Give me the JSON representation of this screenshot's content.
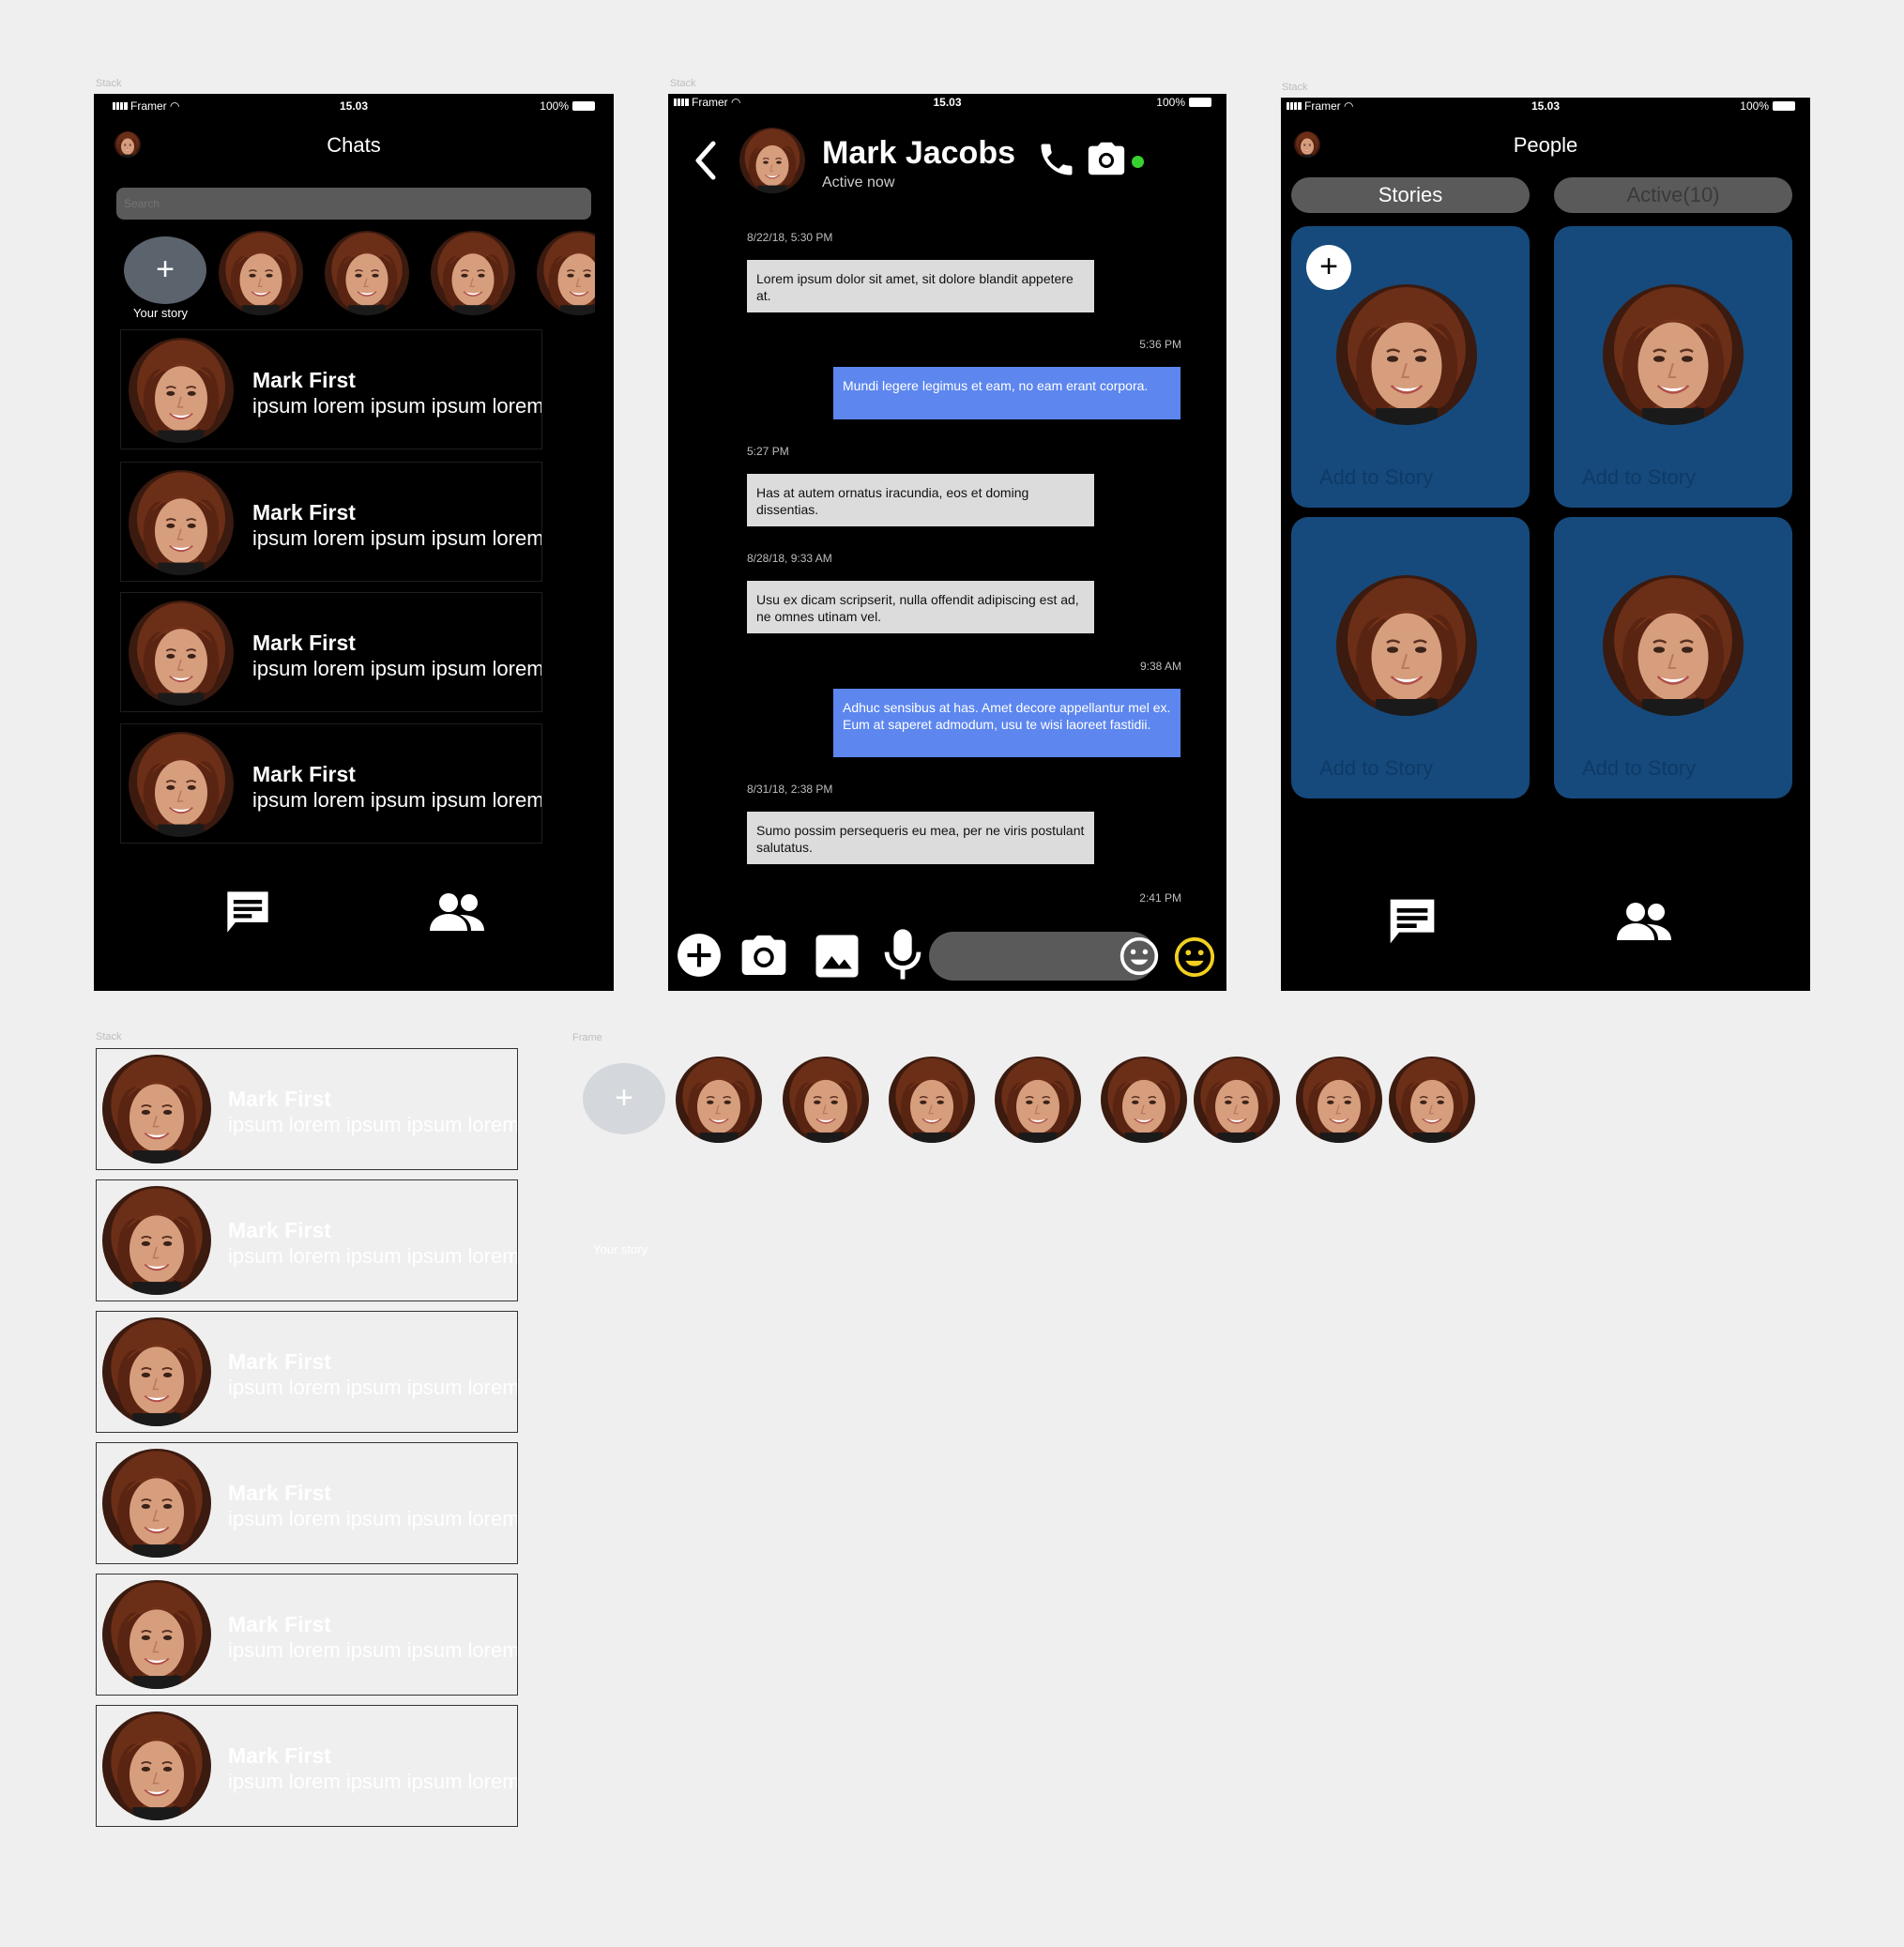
{
  "frame_labels": {
    "stack": "Stack",
    "frame": "Frame"
  },
  "status_bar": {
    "carrier": "Framer",
    "time": "15.03",
    "battery": "100%"
  },
  "chats_screen": {
    "title": "Chats",
    "search_placeholder": "Search",
    "story_add_symbol": "+",
    "your_story_label": "Your story",
    "rows": [
      {
        "name": "Mark First",
        "message": "ipsum lorem ipsum ipsum lorem"
      },
      {
        "name": "Mark First",
        "message": "ipsum lorem ipsum ipsum lorem"
      },
      {
        "name": "Mark First",
        "message": "ipsum lorem ipsum ipsum lorem"
      },
      {
        "name": "Mark First",
        "message": "ipsum lorem ipsum ipsum lorem"
      }
    ]
  },
  "conversation_screen": {
    "contact_name": "Mark Jacobs",
    "contact_status": "Active now",
    "messages": [
      {
        "timestamp": "8/22/18, 5:30 PM",
        "text": "Lorem ipsum dolor sit amet, sit dolore blandit appetere at.",
        "direction": "in"
      },
      {
        "timestamp": "5:36 PM",
        "text": "Mundi legere legimus et eam, no eam erant corpora.",
        "direction": "out"
      },
      {
        "timestamp": "5:27 PM",
        "text": "Has at autem ornatus iracundia, eos et doming dissentias.",
        "direction": "in"
      },
      {
        "timestamp": "8/28/18, 9:33 AM",
        "text": "Usu ex dicam scripserit, nulla offendit adipiscing est ad, ne omnes utinam vel.",
        "direction": "in"
      },
      {
        "timestamp": "9:38 AM",
        "text": "Adhuc sensibus at has. Amet decore appellantur mel ex. Eum at saperet admodum, usu te wisi laoreet fastidii.",
        "direction": "out"
      },
      {
        "timestamp": "8/31/18, 2:38 PM",
        "text": "Sumo possim persequeris eu mea, per ne viris postulant salutatus.",
        "direction": "in"
      }
    ],
    "last_timestamp": "2:41 PM",
    "colors": {
      "incoming": "#dcdcdc",
      "outgoing": "#5d86ee",
      "online": "#39d12f",
      "emoji": "#f2d01f"
    }
  },
  "people_screen": {
    "title": "People",
    "tabs": [
      {
        "label": "Stories"
      },
      {
        "label": "Active(10)"
      }
    ],
    "card_add_symbol": "+",
    "cards": [
      {
        "caption": "Add to Story"
      },
      {
        "caption": "Add to Story"
      },
      {
        "caption": "Add to Story"
      },
      {
        "caption": "Add to Story"
      }
    ],
    "card_color": "#164a7c"
  },
  "component_list": {
    "rows": [
      {
        "name": "Mark First",
        "message": "ipsum lorem ipsum ipsum lorem"
      },
      {
        "name": "Mark First",
        "message": "ipsum lorem ipsum ipsum lorem"
      },
      {
        "name": "Mark First",
        "message": "ipsum lorem ipsum ipsum lorem"
      },
      {
        "name": "Mark First",
        "message": "ipsum lorem ipsum ipsum lorem"
      },
      {
        "name": "Mark First",
        "message": "ipsum lorem ipsum ipsum lorem"
      },
      {
        "name": "Mark First",
        "message": "ipsum lorem ipsum ipsum lorem"
      }
    ]
  },
  "story_component": {
    "add_symbol": "+",
    "your_story_label": "Your story"
  }
}
